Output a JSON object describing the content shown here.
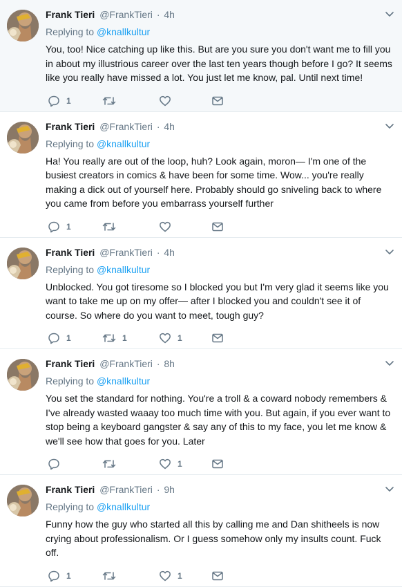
{
  "colors": {
    "accent": "#1da1f2",
    "muted": "#657786",
    "border": "#e6ecf0",
    "highlight_bg": "#f5f8fa"
  },
  "icons": {
    "reply": "reply-icon",
    "retweet": "retweet-icon",
    "like": "heart-icon",
    "dm": "envelope-icon",
    "caret": "chevron-down-icon"
  },
  "tweets": [
    {
      "name": "Frank Tieri",
      "handle": "@FrankTieri",
      "sep": "·",
      "time": "4h",
      "replying_label": "Replying to",
      "replying_to": "@knallkultur",
      "text": "You, too! Nice catching up like this. But are you sure you don't want me to fill you in about my illustrious career over the last ten years though before I go? It seems like you really have missed a lot. You just let me know, pal. Until next time!",
      "replies": "1",
      "retweets": "",
      "likes": ""
    },
    {
      "name": "Frank Tieri",
      "handle": "@FrankTieri",
      "sep": "·",
      "time": "4h",
      "replying_label": "Replying to",
      "replying_to": "@knallkultur",
      "text": "Ha! You really are out of the loop, huh? Look again, moron— I'm one of the busiest creators in comics & have been for some time. Wow... you're really making a dick out of yourself here. Probably should go sniveling back to where you came from before you embarrass yourself further",
      "replies": "1",
      "retweets": "",
      "likes": ""
    },
    {
      "name": "Frank Tieri",
      "handle": "@FrankTieri",
      "sep": "·",
      "time": "4h",
      "replying_label": "Replying to",
      "replying_to": "@knallkultur",
      "text": "Unblocked. You got tiresome so I blocked you but I'm very glad it seems like you want to take me up on my offer— after I blocked you and couldn't see it of course. So where do you want to meet, tough guy?",
      "replies": "1",
      "retweets": "1",
      "likes": "1"
    },
    {
      "name": "Frank Tieri",
      "handle": "@FrankTieri",
      "sep": "·",
      "time": "8h",
      "replying_label": "Replying to",
      "replying_to": "@knallkultur",
      "text": "You set the standard for nothing. You're a troll & a coward nobody remembers & I've already wasted waaay too much time with you. But again, if you ever want to stop being a keyboard gangster & say any of this to my face, you let me know & we'll see how that goes for you. Later",
      "replies": "",
      "retweets": "",
      "likes": "1"
    },
    {
      "name": "Frank Tieri",
      "handle": "@FrankTieri",
      "sep": "·",
      "time": "9h",
      "replying_label": "Replying to",
      "replying_to": "@knallkultur",
      "text": "Funny how the guy who started all this by calling me and Dan shitheels is now crying about professionalism. Or I guess somehow only my insults count. Fuck off.",
      "replies": "1",
      "retweets": "",
      "likes": "1"
    }
  ]
}
